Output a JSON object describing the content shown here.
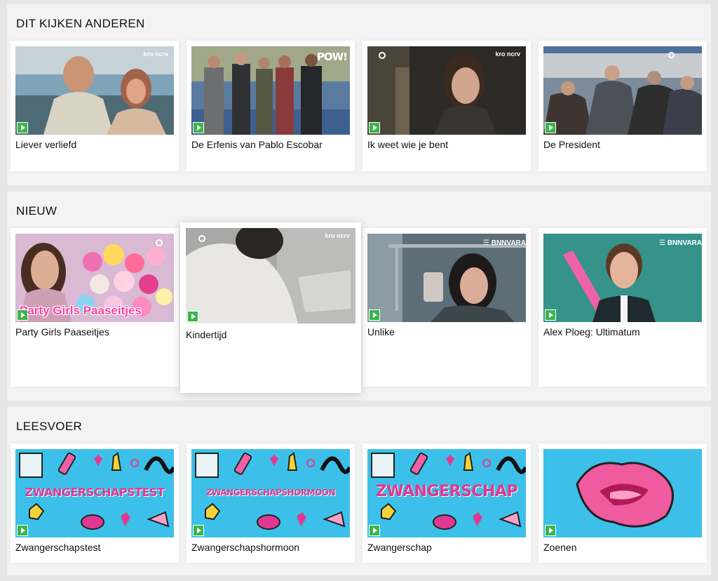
{
  "sections": {
    "trending": {
      "title": "DIT KIJKEN ANDEREN",
      "items": [
        {
          "title": "Liever verliefd",
          "logo": "kro ncrv"
        },
        {
          "title": "De Erfenis van Pablo Escobar",
          "logo": "POW!"
        },
        {
          "title": "Ik weet wie je bent",
          "logo": "kro ncrv"
        },
        {
          "title": "De President",
          "logo": ""
        }
      ]
    },
    "new": {
      "title": "NIEUW",
      "items": [
        {
          "title": "Party Girls Paaseitjes",
          "overlay": "Party Girls Paaseitjes"
        },
        {
          "title": "Kindertijd",
          "logo": "kro ncrv"
        },
        {
          "title": "Unlike",
          "logo": "BNNVARA"
        },
        {
          "title": "Alex Ploeg: Ultimatum",
          "logo": "BNNVARA"
        }
      ]
    },
    "reading": {
      "title": "LEESVOER",
      "items": [
        {
          "title": "Zwangerschapstest",
          "overlay": "ZWANGERSCHAPSTEST"
        },
        {
          "title": "Zwangerschapshormoon",
          "overlay": "ZWANGERSCHAPSHORMOON"
        },
        {
          "title": "Zwangerschap",
          "overlay": "ZWANGERSCHAP"
        },
        {
          "title": "Zoenen"
        }
      ]
    }
  },
  "colors": {
    "play": "#3ab54a",
    "lees_bg": "#3cc0ea",
    "lees_text": "#e0398f"
  }
}
